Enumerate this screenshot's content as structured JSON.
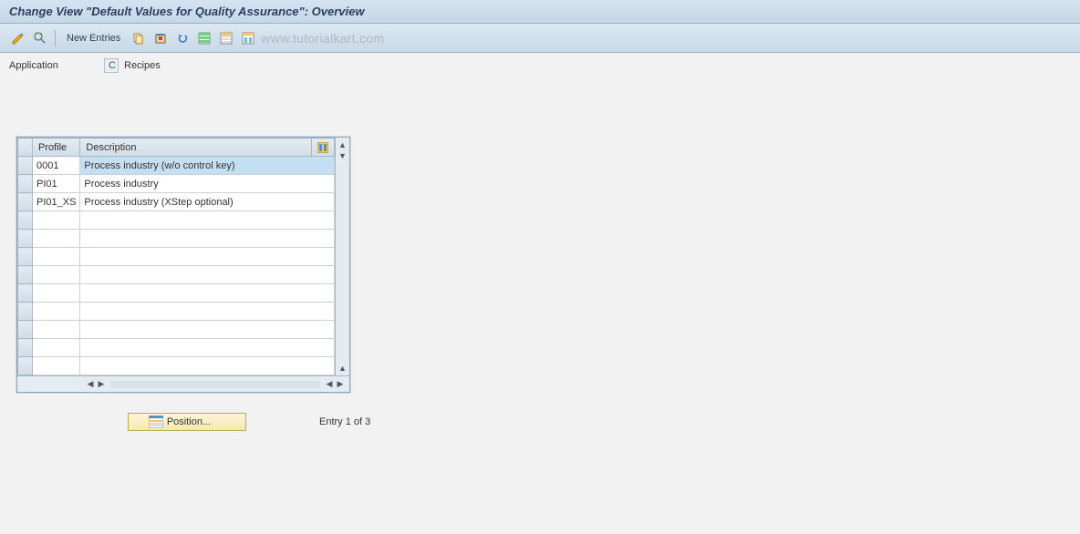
{
  "title": "Change View \"Default Values for Quality Assurance\": Overview",
  "toolbar": {
    "new_entries_label": "New Entries"
  },
  "watermark": "www.tutorialkart.com",
  "application": {
    "label": "Application",
    "code": "C",
    "text": "Recipes"
  },
  "table": {
    "headers": {
      "profile": "Profile",
      "description": "Description"
    },
    "rows": [
      {
        "profile": "0001",
        "description": "Process industry (w/o control key)",
        "selected": true
      },
      {
        "profile": "PI01",
        "description": "Process industry",
        "selected": false
      },
      {
        "profile": "PI01_XS",
        "description": "Process industry (XStep optional)",
        "selected": false
      }
    ],
    "empty_rows": 9
  },
  "position_button": "Position...",
  "entry_status": "Entry 1 of 3"
}
